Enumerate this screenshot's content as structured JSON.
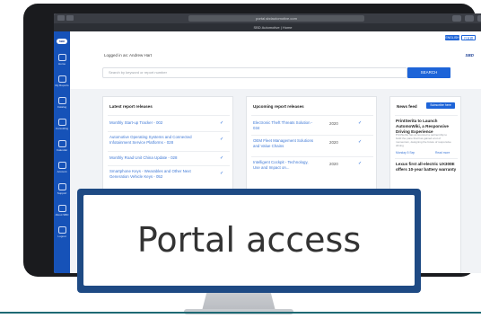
{
  "browser": {
    "url": "portal.sbdautomotive.com",
    "tab_title": "SBD Automotive | Home"
  },
  "sidebar": {
    "brand": "SBD",
    "items": [
      {
        "label": "Home"
      },
      {
        "label": "My Reports"
      },
      {
        "label": "Catalog"
      },
      {
        "label": "Consulting"
      },
      {
        "label": "Calendar"
      },
      {
        "label": "Account"
      },
      {
        "label": "Support"
      },
      {
        "label": "About SBD"
      },
      {
        "label": "Logout"
      }
    ]
  },
  "header": {
    "lang_primary": "ENGLISH",
    "lang_secondary": "日本語",
    "logged_in": "Logged in as: Andrew Hart",
    "brand": "SBD"
  },
  "search": {
    "placeholder": "Search by keyword or report number",
    "button": "SEARCH"
  },
  "latest": {
    "title": "Latest report releases",
    "rows": [
      "Monthly Start-up Tracker - 002",
      "Automotive Operating Systems and Connected Infotainment Service Platforms - 028",
      "Monthly Road Unit China Update - 028",
      "Smartphone Keys - Wearables and Other Next Generation Vehicle Keys - 052"
    ]
  },
  "upcoming": {
    "title": "Upcoming report releases",
    "rows": [
      {
        "title": "Electronic Theft Threats Solution - 034",
        "year": "2020"
      },
      {
        "title": "OEM Fleet Management Solutions and Value Chains",
        "year": "2020"
      },
      {
        "title": "Intelligent Cockpit - Technology, Use and Impact on...",
        "year": "2020"
      }
    ]
  },
  "news": {
    "title": "News feed",
    "subscribe": "Subscribe here",
    "item1_title": "PrintSerita to Launch AutomoWiki, a Responsive Driving Experience",
    "item1_body": "PrintSerita has announced a partnership to build the pane that has gained a lot of momentum, designing the future of responsive driving",
    "item1_date": "Monday 5 Sep",
    "item1_link": "Read more",
    "item2_title": "Lexus first all-electric UX300E offers 10-year battery warranty"
  },
  "overlay": {
    "text": "Portal access"
  }
}
